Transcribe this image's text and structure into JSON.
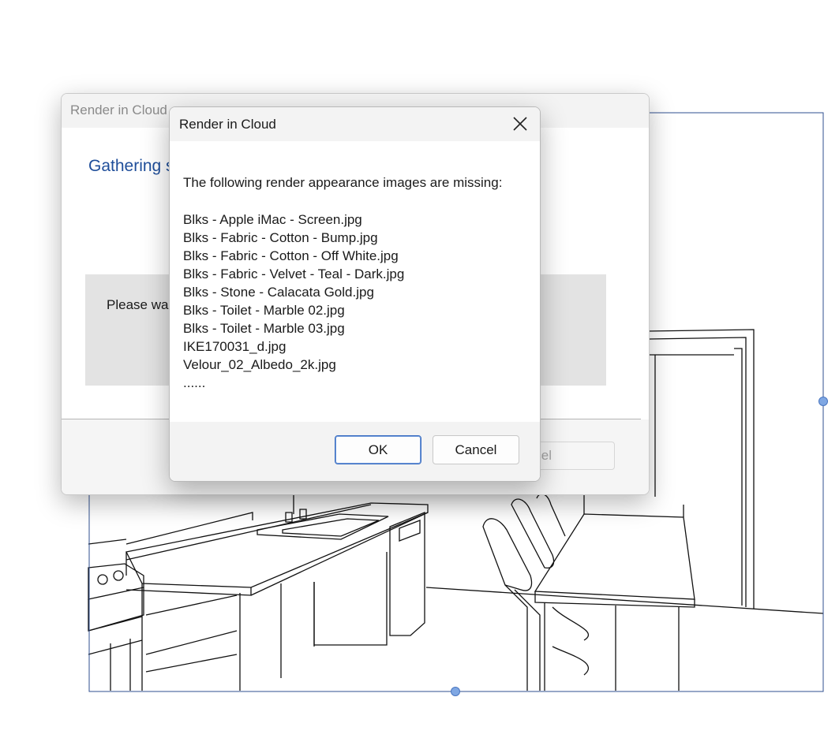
{
  "back_dialog": {
    "title": "Render in Cloud",
    "heading": "Gathering s",
    "status": "Please wai",
    "cancel_label": "cel"
  },
  "front_dialog": {
    "title": "Render in Cloud",
    "message": "The following render appearance images are missing:",
    "missing_files": [
      "Blks - Apple iMac - Screen.jpg",
      "Blks - Fabric - Cotton - Bump.jpg",
      "Blks - Fabric - Cotton - Off White.jpg",
      "Blks - Fabric - Velvet - Teal - Dark.jpg",
      "Blks - Stone - Calacata Gold.jpg",
      "Blks - Toilet - Marble 02.jpg",
      "Blks - Toilet - Marble 03.jpg",
      "IKE170031_d.jpg",
      "Velour_02_Albedo_2k.jpg",
      "......"
    ],
    "ok_label": "OK",
    "cancel_label": "Cancel"
  },
  "icons": {
    "close": "close-icon",
    "handles": "resize-handle"
  },
  "colors": {
    "heading_blue": "#1f4e9a",
    "ok_border": "#3c6fc2",
    "crop_border": "#2f4f8f"
  }
}
